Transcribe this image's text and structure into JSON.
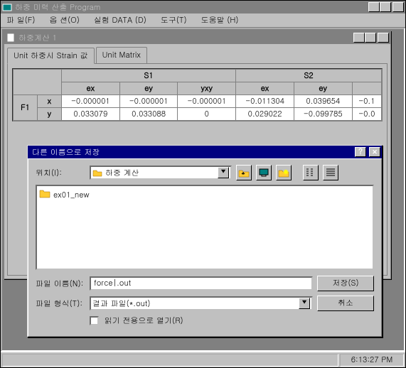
{
  "main": {
    "title": "하중 미력 산출 Program",
    "menus": {
      "file": "파 일(F)",
      "options": "옵 션(O)",
      "data": "실험 DATA (D)",
      "tools": "도구(T)",
      "help": "도움말 (H)"
    }
  },
  "status": {
    "time": "6:13:27 PM"
  },
  "child": {
    "title": "하중계산 1",
    "tabs": {
      "t1": "Unit 하중시 Strain 값",
      "t2": "Unit Matrix"
    },
    "grid": {
      "groups": {
        "s1": "S1",
        "s2": "S2"
      },
      "cols": {
        "ex": "ex",
        "ey": "ey",
        "yxy": "yxy",
        "ex2": "ex",
        "ey2": "ey"
      },
      "rowlabels": {
        "r1": "x",
        "r2": "y",
        "f1": "F1"
      },
      "r1c1": "-0.000001",
      "r1c2": "-0.000001",
      "r1c3": "-0.000001",
      "r1c4": "-0.011304",
      "r1c5": "0.039654",
      "r1c6": "-0.1",
      "r2c1": "0.033079",
      "r2c2": "0.033088",
      "r2c3": "0",
      "r2c4": "0.029022",
      "r2c5": "-0.099785",
      "r2c6": "-0.0"
    }
  },
  "dialog": {
    "title": "다른 이름으로 저장",
    "loc_label": "위치(I):",
    "loc_value": "하중 계산",
    "file_item": "ex01_new",
    "name_label": "파일 이름(N):",
    "name_value": "force|.out",
    "type_label": "파일 형식(T):",
    "type_value": "결과 파일(*.out)",
    "save_btn": "저장(S)",
    "cancel_btn": "취소",
    "readonly_label": "읽기 전용으로 열기(R)"
  },
  "chart_data": {
    "type": "table",
    "title": "Unit 하중시 Strain 값",
    "column_groups": [
      "S1",
      "S1",
      "S1",
      "S2",
      "S2"
    ],
    "columns": [
      "ex",
      "ey",
      "yxy",
      "ex",
      "ey"
    ],
    "rows": [
      {
        "group": "F1",
        "axis": "x",
        "values": [
          -1e-06,
          -1e-06,
          -1e-06,
          -0.011304,
          0.039654
        ]
      },
      {
        "group": "F1",
        "axis": "y",
        "values": [
          0.033079,
          0.033088,
          0,
          0.029022,
          -0.099785
        ]
      }
    ]
  }
}
